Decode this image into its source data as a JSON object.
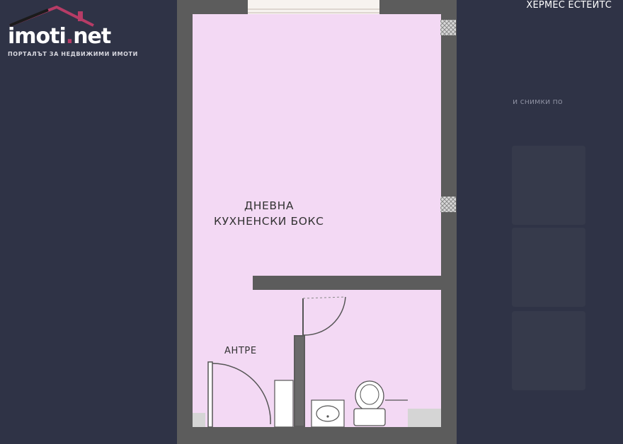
{
  "brand": {
    "logo_main": "imoti",
    "logo_dot": ".",
    "logo_suffix": "net",
    "tagline": "ПОРТАЛЪТ ЗА НЕДВИЖИМИ ИМОТИ"
  },
  "agency_name": "ХЕРМЕС ЕСТЕЙТС",
  "sidebar": {
    "caption": "и снимки по"
  },
  "floor_plan": {
    "rooms": [
      {
        "line1": "ДНЕВНА",
        "line2": "КУХНЕНСКИ БОКС"
      },
      {
        "line1": "АНТРЕ"
      }
    ]
  },
  "colors": {
    "background": "#2f3346",
    "room_fill": "#f3d9f4",
    "wall": "#5a5a5a",
    "brand_accent": "#b73c66"
  }
}
